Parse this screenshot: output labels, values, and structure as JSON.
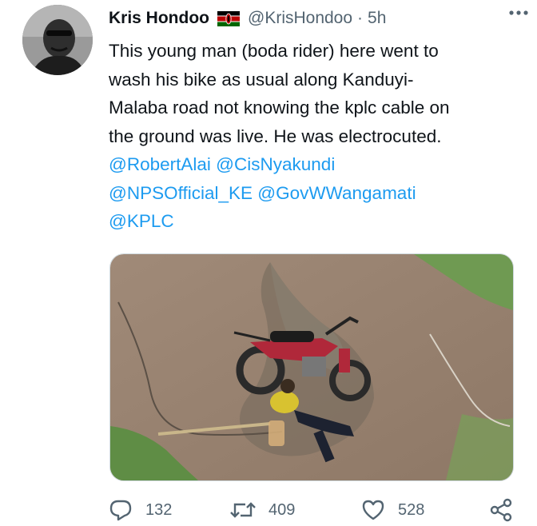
{
  "user": {
    "display_name": "Kris Hondoo",
    "handle": "@KrisHondoo",
    "separator": "·",
    "time": "5h",
    "flag_icon": "kenya-flag-icon"
  },
  "tweet": {
    "lines": [
      "This young man (boda rider) here went to",
      "wash his bike as usual along Kanduyi-",
      "Malaba road not knowing the kplc cable on",
      "the ground was live. He was electrocuted."
    ],
    "mentions_line1": [
      "@RobertAlai",
      "@CisNyakundi"
    ],
    "mentions_line2": [
      "@NPSOfficial_KE",
      "@GovWWangamati"
    ],
    "mentions_line3": [
      "@KPLC"
    ]
  },
  "actions": {
    "reply_count": "132",
    "retweet_count": "409",
    "like_count": "528"
  },
  "colors": {
    "mention": "#1d9bf0",
    "secondary_text": "#536471",
    "primary_text": "#0f1419"
  }
}
